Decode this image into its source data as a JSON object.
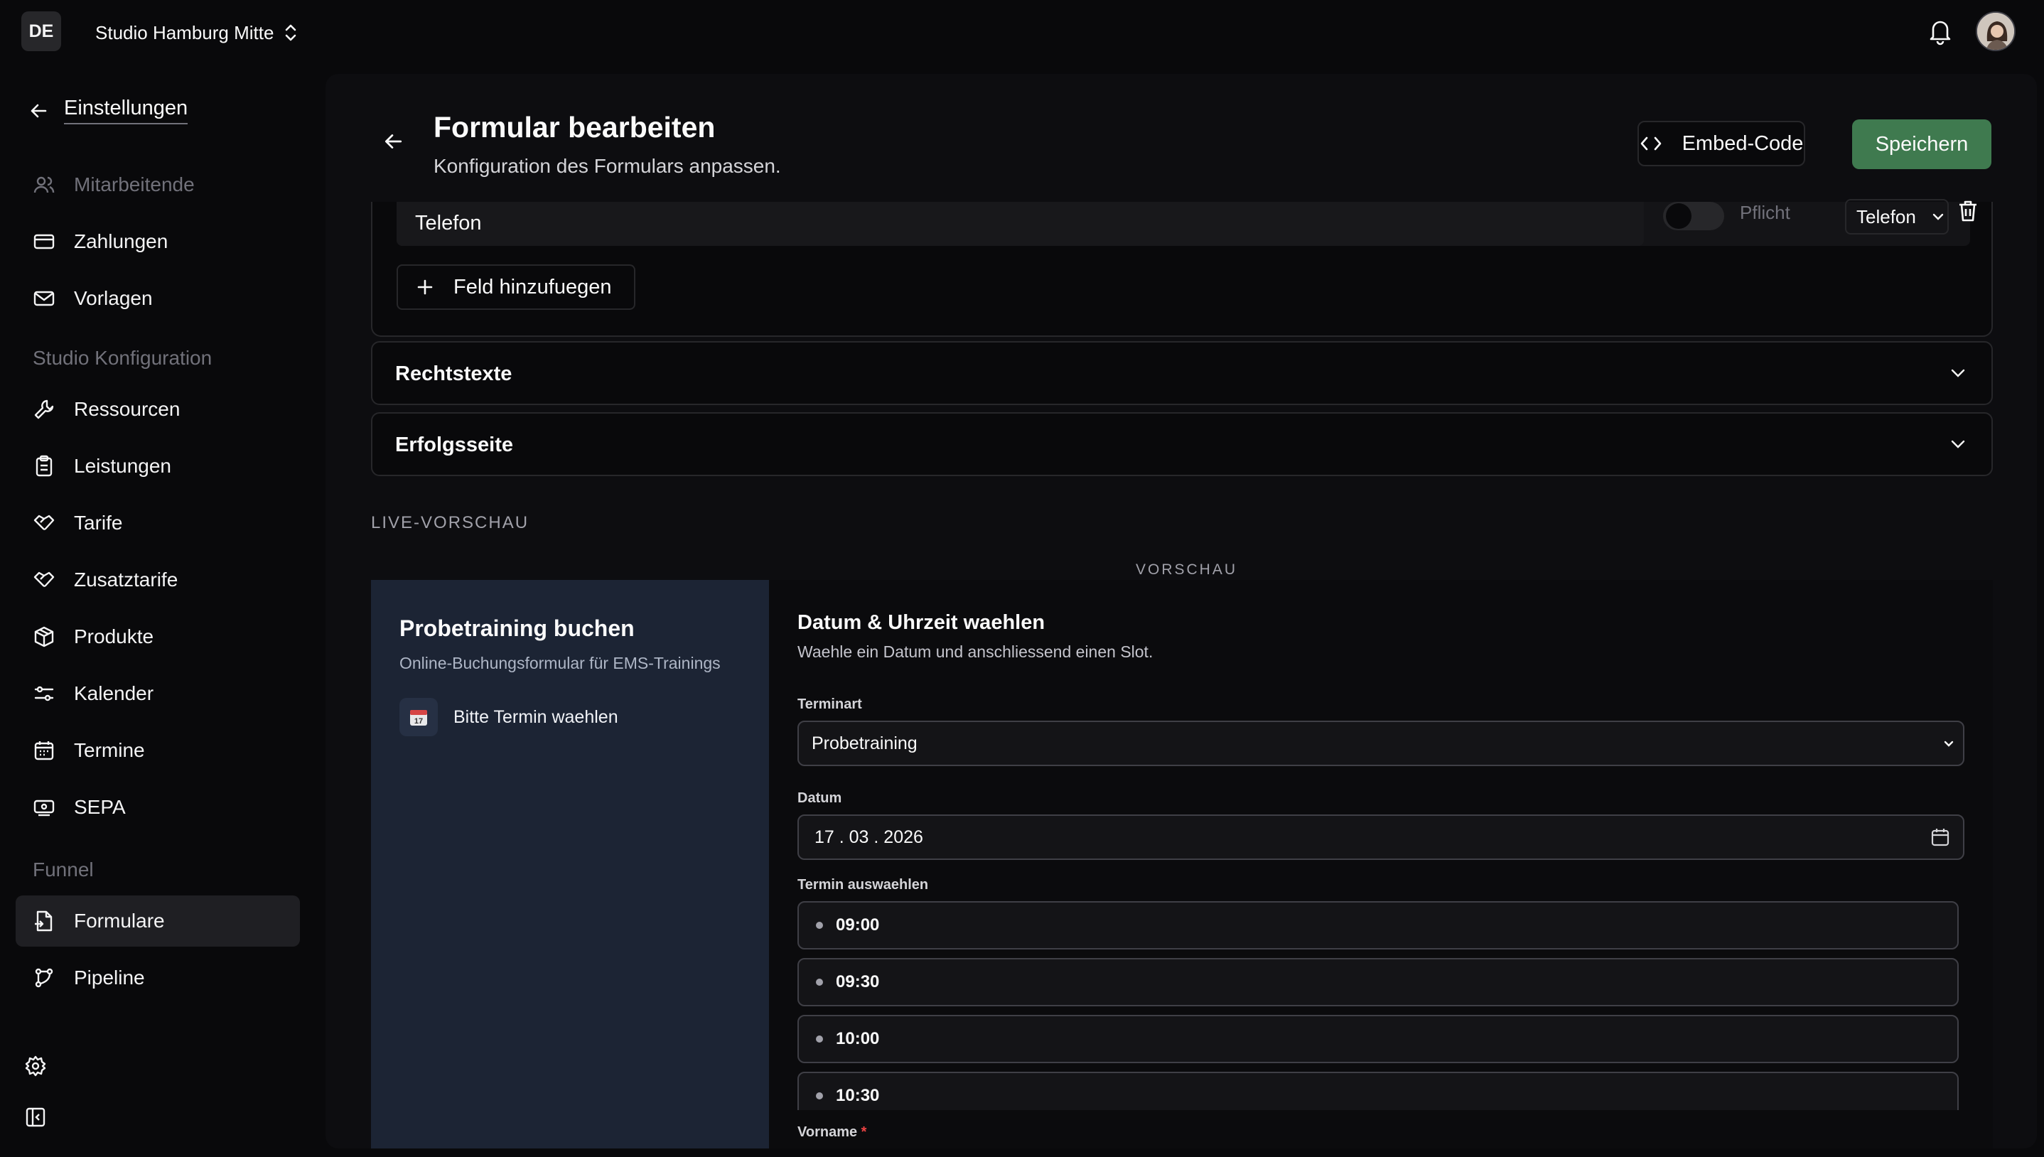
{
  "topbar": {
    "lang": "DE",
    "studio": "Studio Hamburg Mitte"
  },
  "sidebar": {
    "back_label": "Einstellungen",
    "items_top": [
      {
        "label": "Mitarbeitende",
        "icon": "users-icon",
        "muted": true
      },
      {
        "label": "Zahlungen",
        "icon": "credit-card-icon"
      },
      {
        "label": "Vorlagen",
        "icon": "mail-icon"
      }
    ],
    "section_studio": "Studio Konfiguration",
    "items_studio": [
      {
        "label": "Ressourcen",
        "icon": "wrench-icon"
      },
      {
        "label": "Leistungen",
        "icon": "clipboard-icon"
      },
      {
        "label": "Tarife",
        "icon": "handshake-icon"
      },
      {
        "label": "Zusatztarife",
        "icon": "handshake-icon"
      },
      {
        "label": "Produkte",
        "icon": "package-icon"
      },
      {
        "label": "Kalender",
        "icon": "sliders-icon"
      },
      {
        "label": "Termine",
        "icon": "calendar-icon"
      },
      {
        "label": "SEPA",
        "icon": "banknote-icon"
      }
    ],
    "section_funnel": "Funnel",
    "items_funnel": [
      {
        "label": "Formulare",
        "icon": "form-icon",
        "active": true
      },
      {
        "label": "Pipeline",
        "icon": "workflow-icon"
      }
    ]
  },
  "header": {
    "title": "Formular bearbeiten",
    "subtitle": "Konfiguration des Formulars anpassen.",
    "embed_label": "Embed-Code",
    "save_label": "Speichern"
  },
  "fields": {
    "field_name": "Telefon",
    "required_label": "Pflicht",
    "required": false,
    "type_value": "Telefon",
    "add_label": "Feld hinzufuegen"
  },
  "sections": {
    "legal": "Rechtstexte",
    "success": "Erfolgsseite"
  },
  "live_label": "LIVE-VORSCHAU",
  "preview": {
    "label": "VORSCHAU",
    "title": "Probetraining buchen",
    "subtitle": "Online-Buchungsformular für EMS-Trainings",
    "step": "Bitte Termin waehlen",
    "step_icon_text": "17",
    "heading": "Datum & Uhrzeit waehlen",
    "heading_sub": "Waehle ein Datum und anschliessend einen Slot.",
    "appointment_type_label": "Terminart",
    "appointment_type_value": "Probetraining",
    "date_label": "Datum",
    "date_value": "17 . 03 . 2026",
    "slot_label": "Termin auswaehlen",
    "slots": [
      "09:00",
      "09:30",
      "10:00",
      "10:30"
    ],
    "firstname_label": "Vorname",
    "required_marker": "*"
  },
  "colors": {
    "accent_green": "#3f7a4f",
    "preview_left_bg": "#1c2434"
  }
}
